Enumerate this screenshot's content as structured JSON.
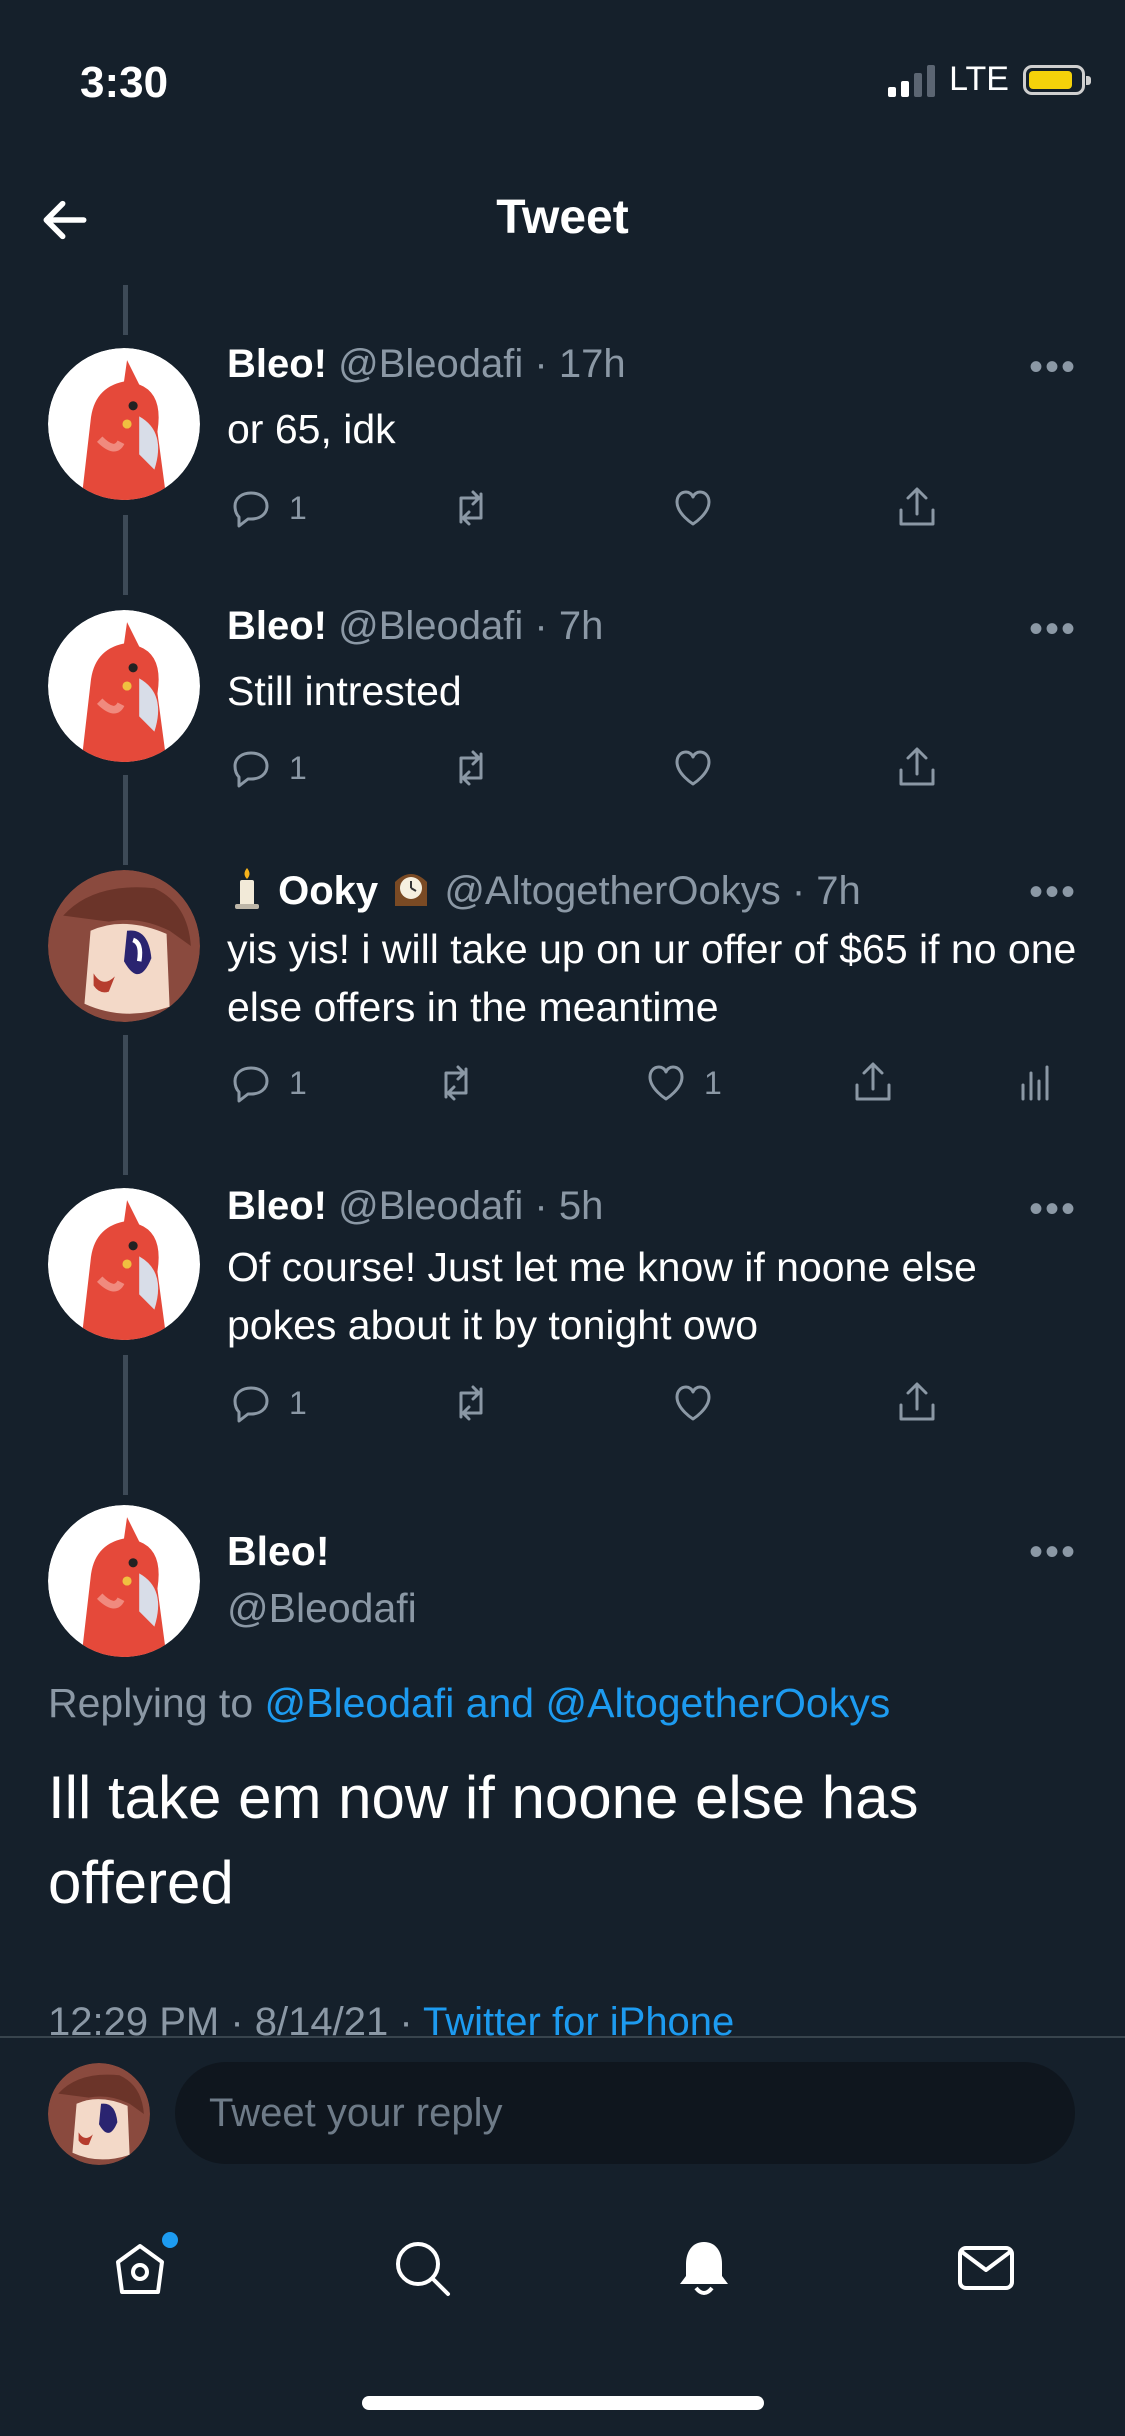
{
  "status": {
    "time": "3:30",
    "network": "LTE",
    "battery_level": 0.85
  },
  "header": {
    "title": "Tweet"
  },
  "tweets": [
    {
      "name": "Bleo!",
      "handle": "@Bleodafi",
      "dot": "·",
      "time": "17h",
      "text": "or 65, idk",
      "reply_count": "1",
      "retweet_count": "",
      "like_count": ""
    },
    {
      "name": "Bleo!",
      "handle": "@Bleodafi",
      "dot": "·",
      "time": "7h",
      "text": "Still intrested",
      "reply_count": "1",
      "retweet_count": "",
      "like_count": ""
    },
    {
      "name": "Ooky",
      "name_prefix_emoji": "candle",
      "name_suffix_emoji": "mantelpiece-clock",
      "handle": "@AltogetherOokys",
      "dot": "·",
      "time": "7h",
      "text": "yis yis! i will take up on ur offer of $65 if no one else offers in the meantime",
      "reply_count": "1",
      "retweet_count": "",
      "like_count": "1"
    },
    {
      "name": "Bleo!",
      "handle": "@Bleodafi",
      "dot": "·",
      "time": "5h",
      "text": "Of course! Just let me know if noone else pokes about it by tonight owo",
      "reply_count": "1",
      "retweet_count": "",
      "like_count": ""
    }
  ],
  "main_tweet": {
    "name": "Bleo!",
    "handle": "@Bleodafi",
    "replying_prefix": "Replying to ",
    "replying_to": "@Bleodafi and @AltogetherOokys",
    "text": "Ill take em now if noone else has offered",
    "timestamp": "12:29 PM · 8/14/21 · ",
    "source": "Twitter for iPhone"
  },
  "more_label": "•••",
  "reply": {
    "placeholder": "Tweet your reply"
  },
  "tabs": [
    "home",
    "search",
    "notifications",
    "messages"
  ],
  "colors": {
    "background": "#15202b",
    "accent": "#1d9bf0",
    "muted": "#8b98a5",
    "battery": "#f5d20a"
  }
}
